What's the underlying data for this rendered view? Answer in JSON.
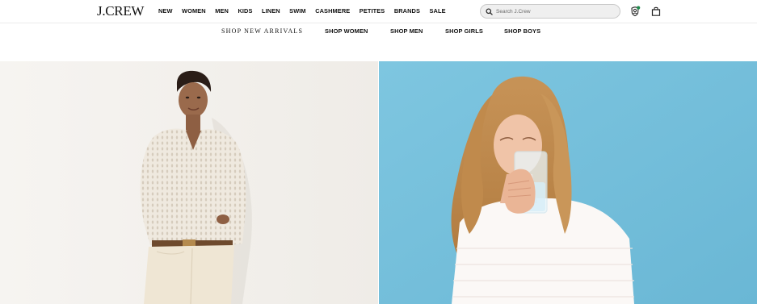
{
  "header": {
    "logo": "J.CREW",
    "nav": [
      "NEW",
      "WOMEN",
      "MEN",
      "KIDS",
      "LINEN",
      "SWIM",
      "CASHMERE",
      "PETITES",
      "BRANDS",
      "SALE"
    ],
    "search_placeholder": "Search J.Crew",
    "icons": [
      "search-icon",
      "account-icon",
      "bag-icon"
    ]
  },
  "subnav": {
    "items": [
      "SHOP NEW ARRIVALS",
      "SHOP WOMEN",
      "SHOP MEN",
      "SHOP GIRLS",
      "SHOP BOYS"
    ]
  },
  "hero": {
    "left_image": "woman-in-white-crochet-sweater",
    "right_image": "woman-drinking-water-in-white-eyelet-top"
  },
  "colors": {
    "right_panel_bg": "#7fc3dd",
    "left_panel_bg": "#f3f1ee",
    "account_badge": "#1f8a4c"
  }
}
